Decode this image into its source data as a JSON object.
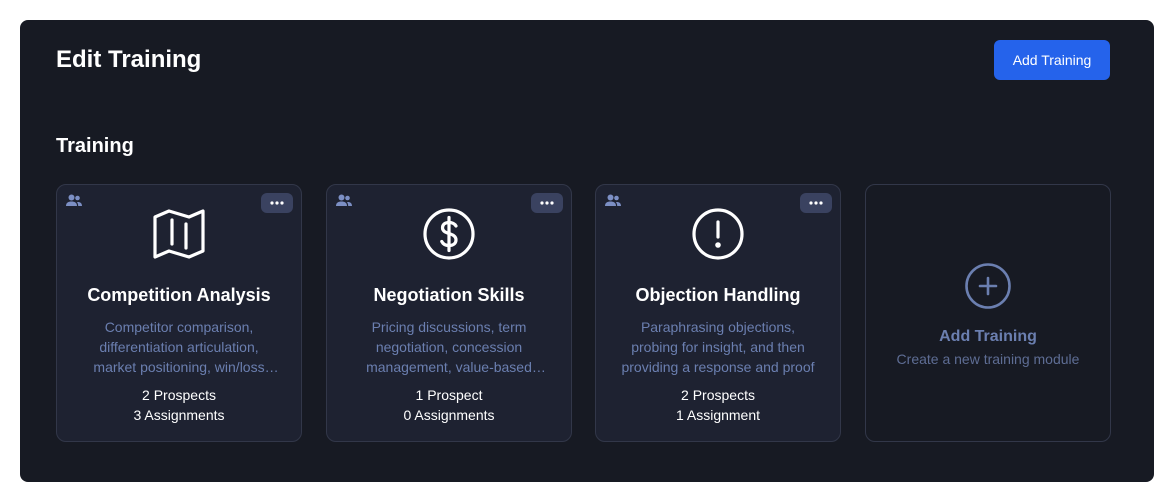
{
  "header": {
    "title": "Edit Training",
    "add_button_label": "Add Training"
  },
  "section": {
    "title": "Training"
  },
  "cards": [
    {
      "title": "Competition Analysis",
      "description": "Competitor comparison, differentiation articulation, market positioning, win/loss analysis",
      "prospects": "2 Prospects",
      "assignments": "3 Assignments",
      "icon": "map-icon"
    },
    {
      "title": "Negotiation Skills",
      "description": "Pricing discussions, term negotiation, concession management, value-based selling",
      "prospects": "1 Prospect",
      "assignments": "0 Assignments",
      "icon": "dollar-circle-icon"
    },
    {
      "title": "Objection Handling",
      "description": "Paraphrasing objections, probing for insight, and then providing a response and proof",
      "prospects": "2 Prospects",
      "assignments": "1 Assignment",
      "icon": "alert-circle-icon"
    }
  ],
  "add_card": {
    "title": "Add Training",
    "subtitle": "Create a new training module",
    "icon": "plus-circle-icon"
  },
  "colors": {
    "panel_bg": "#171a23",
    "card_bg": "#1e2231",
    "accent": "#2563eb",
    "muted_text": "#6b7fb0"
  }
}
